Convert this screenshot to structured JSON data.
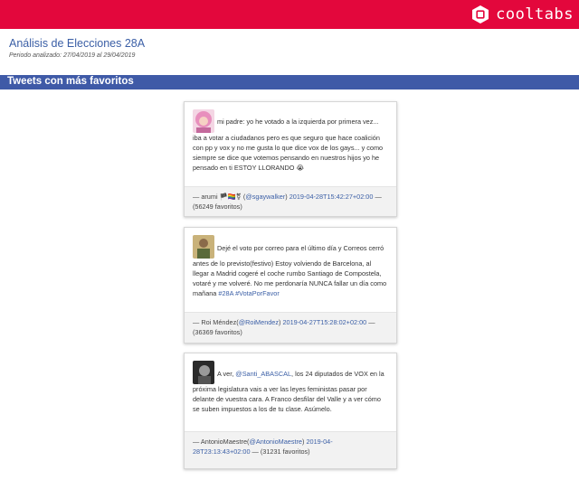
{
  "header": {
    "brand_name": "cooltabs",
    "brand_color": "#e3073c"
  },
  "report": {
    "title": "Análisis de Elecciones 28A",
    "period_label": "Periodo analizado:",
    "period_value": "27/04/2019 al 29/04/2019"
  },
  "section": {
    "title": "Tweets con más favoritos",
    "color": "#3f5aa7"
  },
  "tweets": [
    {
      "avatar": "avatar-pink-hair",
      "first_line": "mi padre: yo he votado a la izquierda por primera vez...",
      "body": "iba a votar a ciudadanos pero es que seguro que hace coalición con pp y vox y no me gusta lo que dice vox de los gays... y como siempre se dice que votemos pensando en nuestros hijos yo he pensado en ti ESTOY LLORANDO 😭",
      "author_prefix": "— arumi 🏴🏳️‍🌈⚧ (",
      "handle": "@sgaywalker",
      "author_suffix": ") ",
      "timestamp": "2019-04-28T15:42:27+02:00",
      "favorites": " — (56249 favoritos)"
    },
    {
      "avatar": "avatar-man-photo",
      "first_line": "Dejé el voto por correo para el último día y Correos cerró",
      "body_before": "antes de lo previsto(festivo) Estoy volviendo de Barcelona, al llegar a Madrid cogeré el coche rumbo Santiago de Compostela, votaré y me volveré. No me perdonaría NUNCA fallar un día como mañana ",
      "hashtag_1": "#28A",
      "hashtag_2": "#VotaPorFavor",
      "author_prefix": "— Roi Méndez(",
      "handle": "@RoiMendez",
      "author_suffix": ") ",
      "timestamp": "2019-04-27T15:28:02+02:00",
      "favorites": " — (36369 favoritos)"
    },
    {
      "avatar": "avatar-bw-photo",
      "first_line_prefix": "A ver, ",
      "mention": "@Santi_ABASCAL",
      "first_line_suffix": ", los 24 diputados de VOX en la",
      "body": "próxima legislatura vais a ver las leyes feministas pasar por delante de vuestra cara. A Franco desfilar del Valle y a ver cómo se suben impuestos a los de tu clase. Asúmelo.",
      "author_prefix": "— AntonioMaestre(",
      "handle": "@AntonioMaestre",
      "author_suffix": ") ",
      "timestamp": "2019-04-28T23:13:43+02:00",
      "favorites": " — (31231 favoritos)"
    }
  ]
}
